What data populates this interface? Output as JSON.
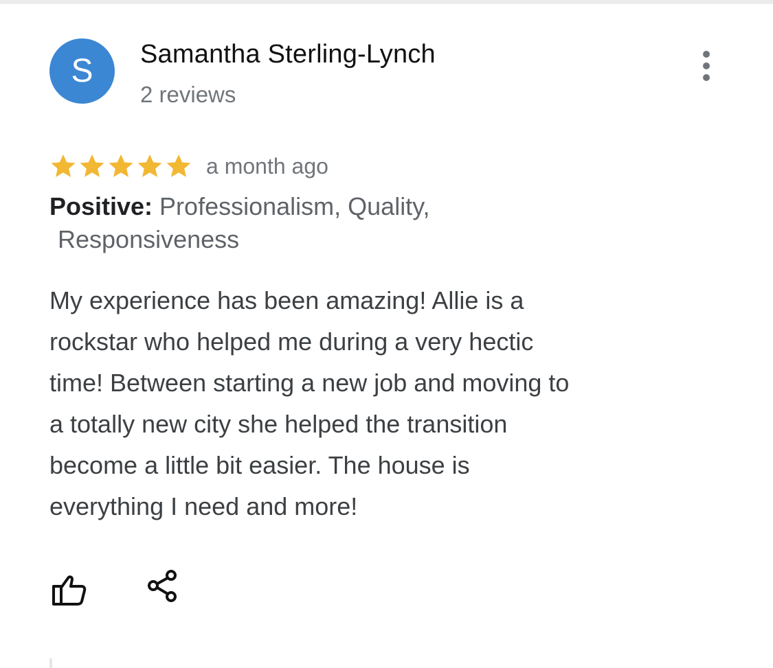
{
  "review": {
    "author": {
      "initial": "S",
      "name": "Samantha Sterling-Lynch",
      "review_count": "2 reviews",
      "avatar_color": "#3b87d4"
    },
    "rating": 5,
    "max_rating": 5,
    "star_color": "#f2b733",
    "date": "a month ago",
    "attributes": {
      "label": "Positive:",
      "line1": " Professionalism, Quality,",
      "line2": "Responsiveness"
    },
    "text_lines": [
      "My experience has been amazing! Allie is a",
      "rockstar who helped me during a very hectic",
      "time! Between starting a new job and moving to",
      "a totally new city she helped the transition",
      "become a little bit easier. The house is",
      "everything I need and more!"
    ],
    "icons": {
      "more": "more-vert-icon",
      "like": "thumb-up-icon",
      "share": "share-icon"
    }
  }
}
